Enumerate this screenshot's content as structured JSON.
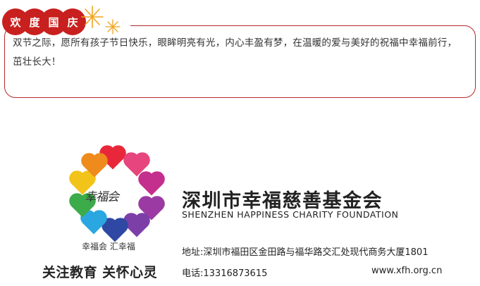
{
  "banner": {
    "heading_chars": [
      "欢",
      "度",
      "国",
      "庆"
    ],
    "message": "双节之际，愿所有孩子节日快乐，眼眸明亮有光，内心丰盈有梦，在温暖的爱与美好的祝福中幸福前行，茁壮长大！",
    "accent_color": "#c8201e"
  },
  "logo": {
    "brand_text": "幸福会",
    "hearts": [
      "#e8283a",
      "#e6457d",
      "#c42e8c",
      "#7c3fa8",
      "#2f48a3",
      "#2aa7e0",
      "#3cab4a",
      "#f2c318",
      "#ef8b1d",
      "#e8283a"
    ],
    "slogan_small": "幸福会  汇幸福",
    "slogan_big": "关注教育 关怀心灵"
  },
  "organization": {
    "name_cn": "深圳市幸福慈善基金会",
    "name_en": "SHENZHEN HAPPINESS CHARITY FOUNDATION",
    "address": "地址:深圳市福田区金田路与福华路交汇处现代商务大厦1801",
    "phone": "电话:13316873615",
    "website": "www.xfh.org.cn"
  }
}
